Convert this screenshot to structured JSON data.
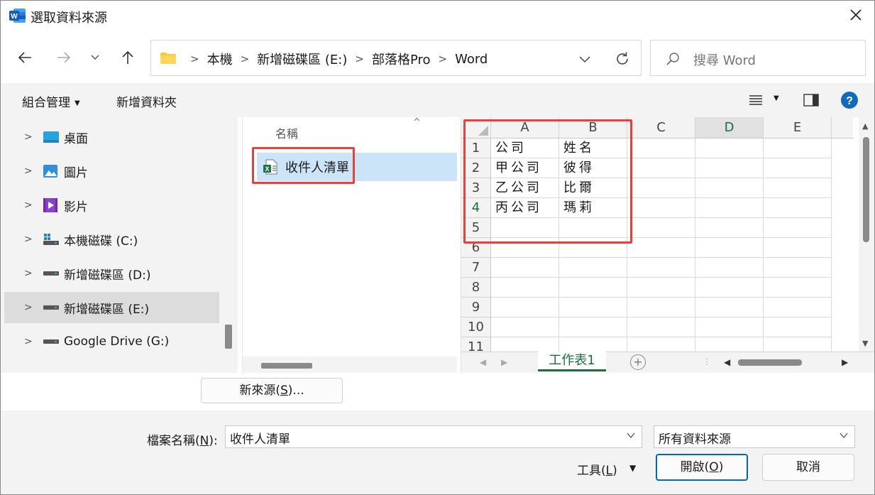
{
  "window": {
    "title": "選取資料來源",
    "app_icon": "word-icon"
  },
  "address": {
    "crumbs": [
      "本機",
      "新增磁碟區 (E:)",
      "部落格Pro",
      "Word"
    ]
  },
  "search": {
    "placeholder": "搜尋 Word"
  },
  "toolbar": {
    "organize": "組合管理",
    "new_folder": "新增資料夾"
  },
  "nav": {
    "items": [
      {
        "label": "桌面",
        "icon": "desktop-icon"
      },
      {
        "label": "圖片",
        "icon": "pictures-icon"
      },
      {
        "label": "影片",
        "icon": "videos-icon"
      },
      {
        "label": "本機磁碟 (C:)",
        "icon": "drive-c-icon"
      },
      {
        "label": "新增磁碟區 (D:)",
        "icon": "drive-icon"
      },
      {
        "label": "新增磁碟區 (E:)",
        "icon": "drive-icon",
        "selected": true
      },
      {
        "label": "Google Drive (G:)",
        "icon": "drive-icon"
      }
    ]
  },
  "files": {
    "column_name": "名稱",
    "items": [
      {
        "name": "收件人清單",
        "icon": "excel-file-icon",
        "selected": true
      }
    ]
  },
  "preview": {
    "columns": [
      "A",
      "B",
      "C",
      "D",
      "E"
    ],
    "rows": [
      "1",
      "2",
      "3",
      "4",
      "5",
      "6",
      "7",
      "8",
      "9",
      "10",
      "11"
    ],
    "cells": [
      [
        "公司",
        "姓名"
      ],
      [
        "甲公司",
        "彼得"
      ],
      [
        "乙公司",
        "比爾"
      ],
      [
        "丙公司",
        "瑪莉"
      ]
    ],
    "sheet_tab": "工作表1"
  },
  "new_source_button": {
    "text": "新來源(",
    "mnemonic": "S",
    "suffix": ")..."
  },
  "filename": {
    "label": "檔案名稱(",
    "mnemonic": "N",
    "suffix": "):",
    "value": "收件人清單"
  },
  "filetype": {
    "value": "所有資料來源"
  },
  "tools": {
    "text": "工具(",
    "mnemonic": "L",
    "suffix": ")"
  },
  "open_button": {
    "text": "開啟(",
    "mnemonic": "O",
    "suffix": ")"
  },
  "cancel_button": {
    "label": "取消"
  },
  "colors": {
    "accent": "#0067c0",
    "highlight": "#e8403a",
    "excel_green": "#1e6b41",
    "selection": "#cce4f7"
  }
}
